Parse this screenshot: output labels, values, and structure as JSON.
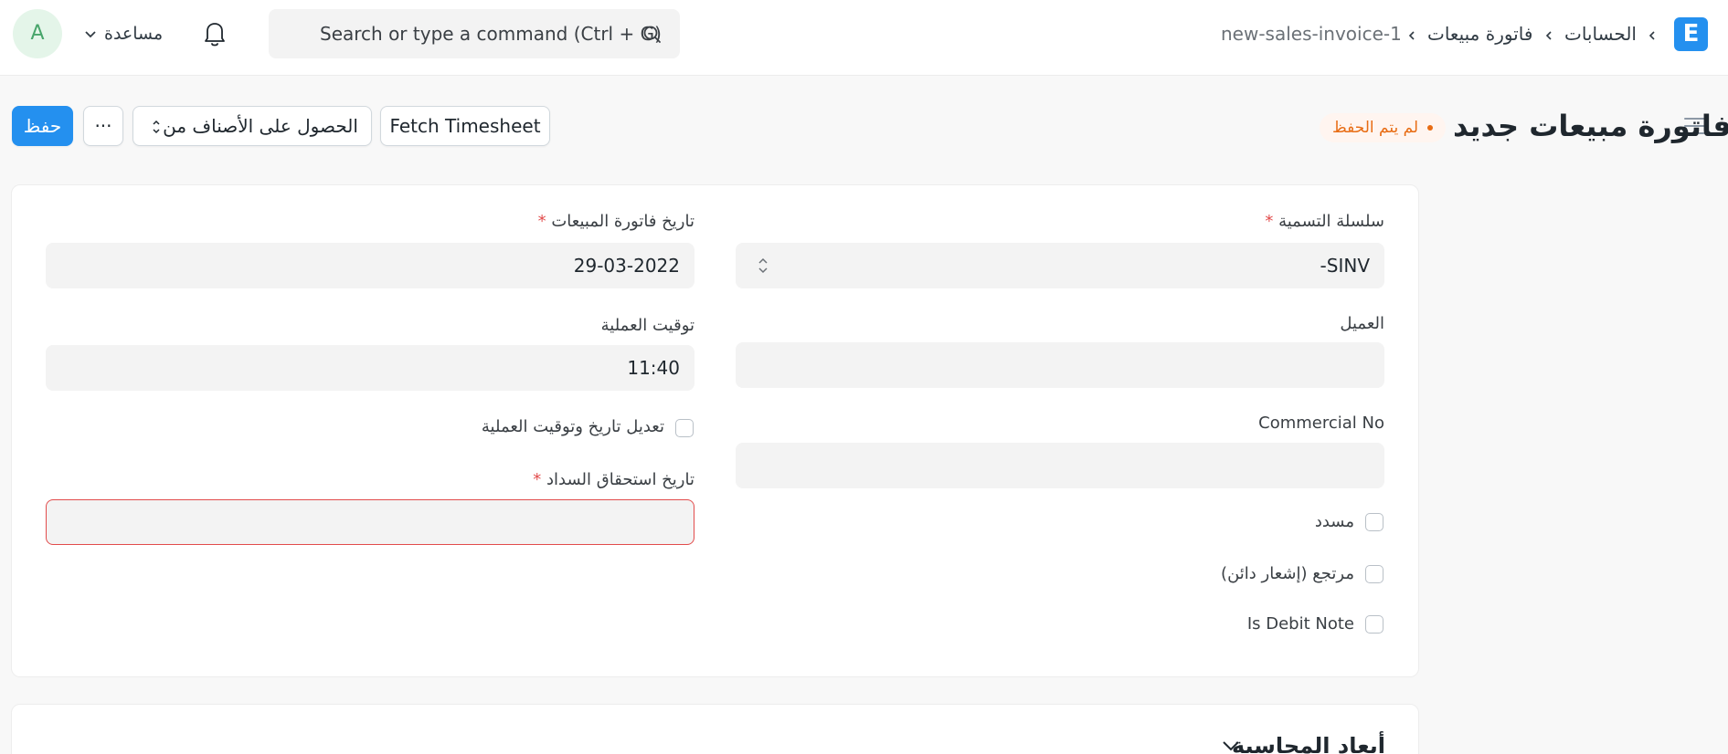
{
  "navbar": {
    "logo_letter": "E",
    "breadcrumbs": [
      "الحسابات",
      "فاتورة مبيعات",
      "new-sales-invoice-1"
    ],
    "search_placeholder": "Search or type a command (Ctrl + G)",
    "help_label": "مساعدة",
    "avatar_letter": "A"
  },
  "page_head": {
    "title": "فاتورة مبيعات جديد",
    "status": "لم يتم الحفظ",
    "buttons": {
      "fetch_timesheet": "Fetch Timesheet",
      "get_items_from": "الحصول على الأصناف من",
      "more": "···",
      "save": "حفظ"
    }
  },
  "form": {
    "naming_series": {
      "label": "سلسلة التسمية",
      "required": "*",
      "value": "-SINV"
    },
    "customer": {
      "label": "العميل",
      "value": ""
    },
    "commercial_no": {
      "label": "Commercial No",
      "value": ""
    },
    "is_paid": {
      "label": "مسدد",
      "checked": false
    },
    "is_return": {
      "label": "مرتجع (إشعار دائن)",
      "checked": false
    },
    "is_debit_note": {
      "label": "Is Debit Note",
      "checked": false
    },
    "posting_date": {
      "label": "تاريخ فاتورة المبيعات",
      "required": "*",
      "value": "29-03-2022"
    },
    "posting_time": {
      "label": "توقيت العملية",
      "value": "11:40"
    },
    "set_posting_time": {
      "label": "تعديل تاريخ وتوقيت العملية",
      "checked": false
    },
    "due_date": {
      "label": "تاريخ استحقاق السداد",
      "required": "*",
      "value": ""
    }
  },
  "sections": {
    "accounting_dimensions": "أبعاد المحاسبة"
  },
  "colors": {
    "primary": "#2490ef",
    "status_orange": "#e86c13",
    "error_red": "#e24c4c"
  }
}
